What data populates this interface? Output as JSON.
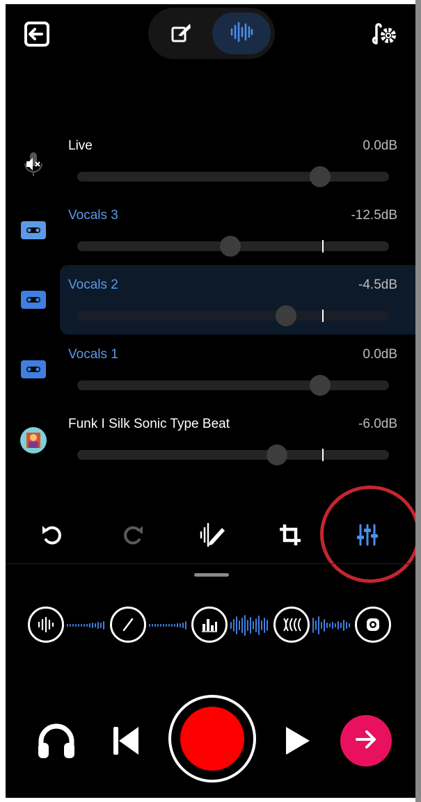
{
  "header": {
    "exit_icon": "exit-icon",
    "modes": [
      {
        "icon": "pen-edit-icon",
        "active": false
      },
      {
        "icon": "waveform-icon",
        "active": true
      }
    ],
    "settings_icon": "music-settings-icon"
  },
  "tracks": [
    {
      "name": "Live",
      "db": "0.0dB",
      "icon": "mic-muted-icon",
      "level": 0.78,
      "selected": false
    },
    {
      "name": "Vocals 3",
      "db": "-12.5dB",
      "icon": "tape-icon",
      "level": 0.49,
      "selected": false
    },
    {
      "name": "Vocals 2",
      "db": "-4.5dB",
      "icon": "tape-icon",
      "level": 0.67,
      "selected": true
    },
    {
      "name": "Vocals 1",
      "db": "0.0dB",
      "icon": "tape-icon",
      "level": 0.78,
      "selected": false
    },
    {
      "name": "Funk I Silk Sonic Type Beat",
      "db": "-6.0dB",
      "icon": "album-art-icon",
      "level": 0.64,
      "selected": false
    }
  ],
  "toolbar": [
    "undo-icon",
    "redo-icon",
    "magic-edit-icon",
    "crop-icon",
    "mixer-sliders-icon"
  ],
  "effects": [
    "waveform-effect-icon",
    "slope-effect-icon",
    "equalizer-effect-icon",
    "reverb-effect-icon",
    "target-effect-icon"
  ],
  "transport": {
    "icons": [
      "headphones-icon",
      "skip-back-icon",
      "record-button",
      "play-icon",
      "next-arrow-icon"
    ]
  },
  "colors": {
    "accent_blue": "#3f7fe0",
    "record_red": "#ff0000",
    "next_pink": "#e9115f",
    "highlight_ring": "#c4262e"
  }
}
